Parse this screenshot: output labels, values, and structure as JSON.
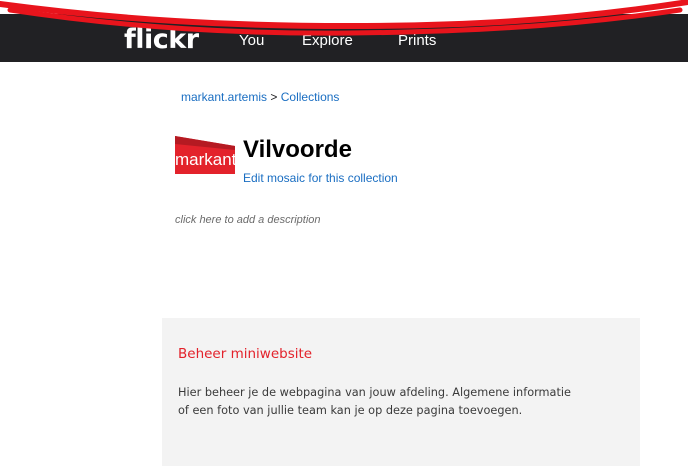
{
  "header": {
    "logo": "flickr",
    "nav": {
      "you": "You",
      "explore": "Explore",
      "prints": "Prints"
    }
  },
  "breadcrumb": {
    "user": "markant.artemis",
    "separator": ">",
    "current": "Collections"
  },
  "collection": {
    "thumbnail_text": "markant",
    "title": "Vilvoorde",
    "edit_link": "Edit mosaic for this collection",
    "description_placeholder": "click here to add a description"
  },
  "info_box": {
    "title": "Beheer miniwebsite",
    "body": "Hier beheer je de webpagina van jouw afdeling. Algemene informatie of een foto van jullie team kan je op deze pagina toevoegen."
  },
  "colors": {
    "annotation_red": "#e8141c",
    "topbar": "#212124",
    "link": "#1a6ec2",
    "accent_red": "#e3222b"
  }
}
